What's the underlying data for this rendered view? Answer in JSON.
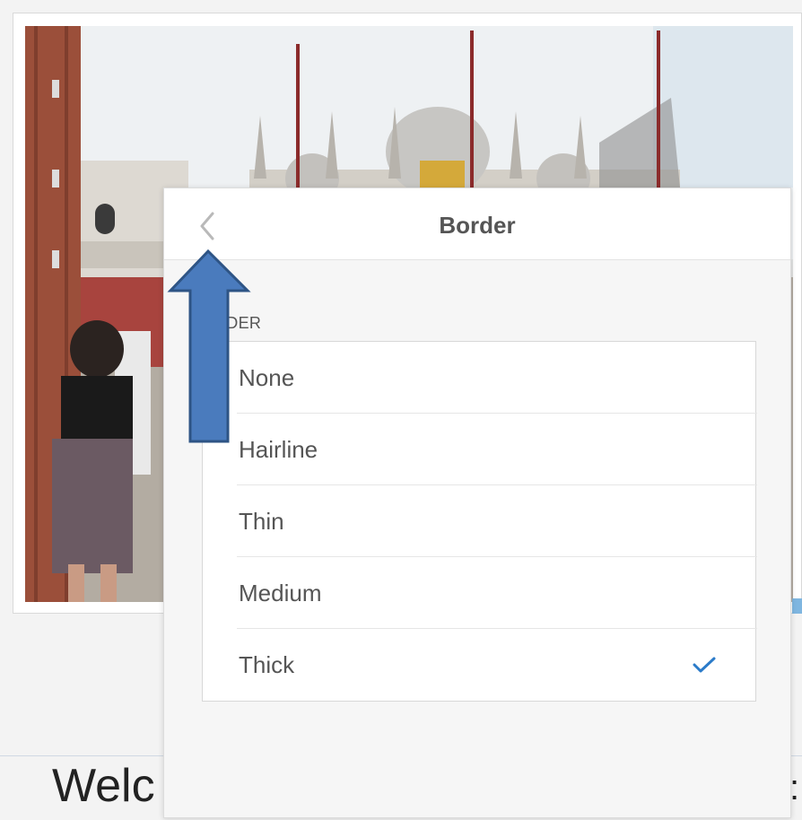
{
  "document": {
    "heading_visible": "Welc",
    "heading_tail_visible": ":"
  },
  "panel": {
    "title": "Border",
    "back_icon": "chevron-left-icon",
    "section_label": "RDER",
    "options": [
      {
        "label": "None",
        "selected": false
      },
      {
        "label": "Hairline",
        "selected": false
      },
      {
        "label": "Thin",
        "selected": false
      },
      {
        "label": "Medium",
        "selected": false
      },
      {
        "label": "Thick",
        "selected": true
      }
    ],
    "check_icon": "checkmark-icon"
  },
  "colors": {
    "accent": "#2b7bc9",
    "annotation_arrow_fill": "#4a7bbd",
    "annotation_arrow_stroke": "#2e5485"
  }
}
